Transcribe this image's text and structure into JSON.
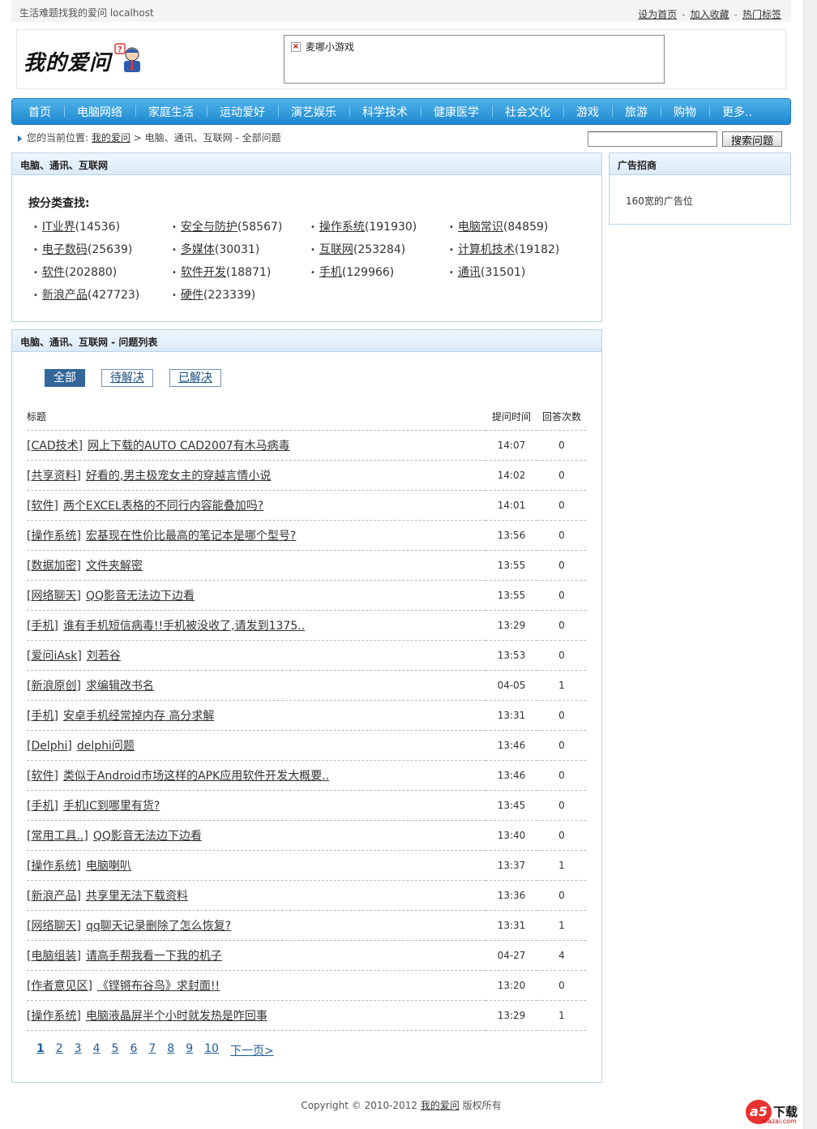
{
  "topbar": {
    "tagline": "生活难题找我的爱问  localhost",
    "links": [
      "设为首页",
      "加入收藏",
      "热门标签"
    ]
  },
  "header": {
    "logo_text": "我的爱问",
    "ad_alt": "麦哪小游戏"
  },
  "nav": [
    "首页",
    "电脑网络",
    "家庭生活",
    "运动爱好",
    "演艺娱乐",
    "科学技术",
    "健康医学",
    "社会文化",
    "游戏",
    "旅游",
    "购物",
    "更多.."
  ],
  "breadcrumb": {
    "prefix": "您的当前位置:",
    "home": "我的爱问",
    "sep": ">",
    "path": "电脑、通讯、互联网 - 全部问题"
  },
  "search": {
    "value": "",
    "button": "搜索问题"
  },
  "category_panel": {
    "title": "电脑、通讯、互联网",
    "find_label": "按分类查找:",
    "items": [
      {
        "name": "IT业界",
        "count": "(14536)"
      },
      {
        "name": "安全与防护",
        "count": "(58567)"
      },
      {
        "name": "操作系统",
        "count": "(191930)"
      },
      {
        "name": "电脑常识",
        "count": "(84859)"
      },
      {
        "name": "电子数码",
        "count": "(25639)"
      },
      {
        "name": "多媒体",
        "count": "(30031)"
      },
      {
        "name": "互联网",
        "count": "(253284)"
      },
      {
        "name": "计算机技术",
        "count": "(19182)"
      },
      {
        "name": "软件",
        "count": "(202880)"
      },
      {
        "name": "软件开发",
        "count": "(18871)"
      },
      {
        "name": "手机",
        "count": "(129966)"
      },
      {
        "name": "通讯",
        "count": "(31501)"
      },
      {
        "name": "新浪产品",
        "count": "(427723)"
      },
      {
        "name": "硬件",
        "count": "(223339)"
      }
    ]
  },
  "ad_panel": {
    "title": "广告招商",
    "text": "160宽的广告位"
  },
  "question_panel": {
    "title": "电脑、通讯、互联网  - 问题列表",
    "tabs": [
      "全部",
      "待解决",
      "已解决"
    ],
    "headers": {
      "title": "标题",
      "time": "提问时间",
      "answers": "回答次数"
    },
    "rows": [
      {
        "cat": "[CAD技术]",
        "title": "网上下载的AUTO CAD2007有木马病毒",
        "time": "14:07",
        "answers": "0"
      },
      {
        "cat": "[共享资料]",
        "title": "好看的,男主极宠女主的穿越言情小说",
        "time": "14:02",
        "answers": "0"
      },
      {
        "cat": "[软件]",
        "title": "两个EXCEL表格的不同行内容能叠加吗?",
        "time": "14:01",
        "answers": "0"
      },
      {
        "cat": "[操作系统]",
        "title": "宏基现在性价比最高的笔记本是哪个型号?",
        "time": "13:56",
        "answers": "0"
      },
      {
        "cat": "[数据加密]",
        "title": "文件夹解密",
        "time": "13:55",
        "answers": "0"
      },
      {
        "cat": "[网络聊天]",
        "title": "QQ影音无法边下边看",
        "time": "13:55",
        "answers": "0"
      },
      {
        "cat": "[手机]",
        "title": "谁有手机短信病毒!!手机被没收了,请发到1375..",
        "time": "13:29",
        "answers": "0"
      },
      {
        "cat": "[爱问iAsk]",
        "title": "刘若谷",
        "time": "13:53",
        "answers": "0"
      },
      {
        "cat": "[新浪原创]",
        "title": "求编辑改书名",
        "time": "04-05",
        "answers": "1"
      },
      {
        "cat": "[手机]",
        "title": "安卓手机经常掉内存 高分求解",
        "time": "13:31",
        "answers": "0"
      },
      {
        "cat": "[Delphi]",
        "title": "delphi问题",
        "time": "13:46",
        "answers": "0"
      },
      {
        "cat": "[软件]",
        "title": "类似于Android市场这样的APK应用软件开发大概要..",
        "time": "13:46",
        "answers": "0"
      },
      {
        "cat": "[手机]",
        "title": "手机IC到哪里有货?",
        "time": "13:45",
        "answers": "0"
      },
      {
        "cat": "[常用工具..]",
        "title": "QQ影音无法边下边看",
        "time": "13:40",
        "answers": "0"
      },
      {
        "cat": "[操作系统]",
        "title": "电脑喇叭",
        "time": "13:37",
        "answers": "1"
      },
      {
        "cat": "[新浪产品]",
        "title": "共享里无法下载资料",
        "time": "13:36",
        "answers": "0"
      },
      {
        "cat": "[网络聊天]",
        "title": "qq聊天记录删除了怎么恢复?",
        "time": "13:31",
        "answers": "1"
      },
      {
        "cat": "[电脑组装]",
        "title": "请高手帮我看一下我的机子",
        "time": "04-27",
        "answers": "4"
      },
      {
        "cat": "[作者意见区]",
        "title": "《铿锵布谷鸟》求封面!!",
        "time": "13:20",
        "answers": "0"
      },
      {
        "cat": "[操作系统]",
        "title": "电脑液晶屏半个小时就发热是咋回事",
        "time": "13:29",
        "answers": "1"
      }
    ],
    "pager": [
      "1",
      "2",
      "3",
      "4",
      "5",
      "6",
      "7",
      "8",
      "9",
      "10",
      "下一页>"
    ],
    "current_page": "1"
  },
  "footer": {
    "copyright": "Copyright © 2010-2012",
    "site": "我的爱问",
    "rights": "版权所有"
  },
  "watermark": {
    "mark": "a5",
    "text": "下载",
    "domain": "xiazai.com"
  }
}
